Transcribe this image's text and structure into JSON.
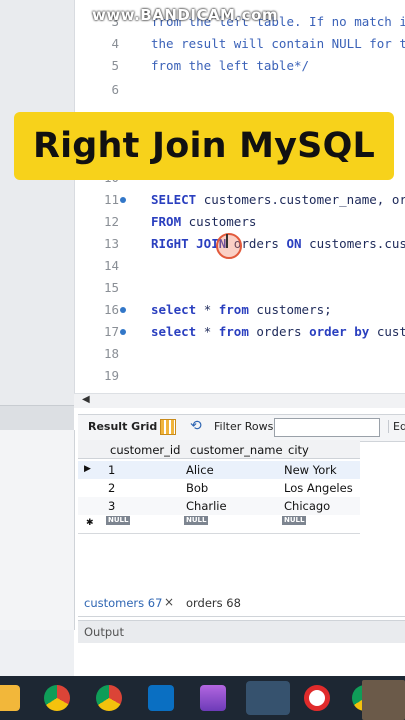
{
  "watermark": "www.BANDICAM.com",
  "title_banner": "Right Join MySQL",
  "editor": {
    "lines": [
      {
        "num": "3",
        "segments": [
          {
            "t": "from the left table. If no match is",
            "c": "cm"
          }
        ]
      },
      {
        "num": "4",
        "segments": [
          {
            "t": "the result will contain NULL for th",
            "c": "cm"
          }
        ]
      },
      {
        "num": "5",
        "segments": [
          {
            "t": "from the left table*/",
            "c": "cm"
          }
        ]
      },
      {
        "num": "6",
        "segments": []
      },
      {
        "num": "10",
        "segments": []
      },
      {
        "num": "11",
        "dot": true,
        "segments": [
          {
            "t": "SELECT ",
            "c": "kw"
          },
          {
            "t": "customers.customer_name, orde",
            "c": "tx"
          }
        ]
      },
      {
        "num": "12",
        "segments": [
          {
            "t": "FROM ",
            "c": "kw"
          },
          {
            "t": "customers",
            "c": "tx"
          }
        ]
      },
      {
        "num": "13",
        "segments": [
          {
            "t": "RIGHT JOIN ",
            "c": "kw"
          },
          {
            "t": "orders ",
            "c": "tx"
          },
          {
            "t": "ON ",
            "c": "kw"
          },
          {
            "t": "customers.cust",
            "c": "tx"
          }
        ]
      },
      {
        "num": "14",
        "segments": []
      },
      {
        "num": "15",
        "segments": []
      },
      {
        "num": "16",
        "dot": true,
        "segments": [
          {
            "t": "select ",
            "c": "kw"
          },
          {
            "t": "* ",
            "c": "tx"
          },
          {
            "t": "from ",
            "c": "kw"
          },
          {
            "t": "customers;",
            "c": "tx"
          }
        ]
      },
      {
        "num": "17",
        "dot": true,
        "segments": [
          {
            "t": "select ",
            "c": "kw"
          },
          {
            "t": "* ",
            "c": "tx"
          },
          {
            "t": "from ",
            "c": "kw"
          },
          {
            "t": "orders ",
            "c": "tx"
          },
          {
            "t": "order by ",
            "c": "kw"
          },
          {
            "t": "custo",
            "c": "tx"
          }
        ]
      },
      {
        "num": "18",
        "segments": []
      },
      {
        "num": "19",
        "segments": []
      }
    ]
  },
  "result_toolbar": {
    "result_grid": "Result Grid",
    "filter_rows": "Filter Rows:",
    "edit": "Edi"
  },
  "grid": {
    "columns": [
      "customer_id",
      "customer_name",
      "city"
    ],
    "rows": [
      {
        "marker": "▶",
        "cells": [
          "1",
          "Alice",
          "New York"
        ]
      },
      {
        "marker": "",
        "cells": [
          "2",
          "Bob",
          "Los Angeles"
        ]
      },
      {
        "marker": "",
        "cells": [
          "3",
          "Charlie",
          "Chicago"
        ]
      }
    ],
    "new_row_marker": "✱",
    "null_label": "NULL"
  },
  "tabs": {
    "customers": "customers 67",
    "close": "×",
    "orders": "orders 68"
  },
  "output": "Output",
  "colors": {
    "banner": "#f7d21b",
    "keyword": "#2a3fbf",
    "comment": "#3b62b8",
    "taskbar": "#1d2733"
  },
  "taskbar_icons": [
    "folder-icon",
    "chrome-icon",
    "chrome-beta-icon",
    "vscode-icon",
    "clapper-icon",
    "mysql-workbench-icon",
    "record-icon",
    "chrome-profile-icon"
  ]
}
